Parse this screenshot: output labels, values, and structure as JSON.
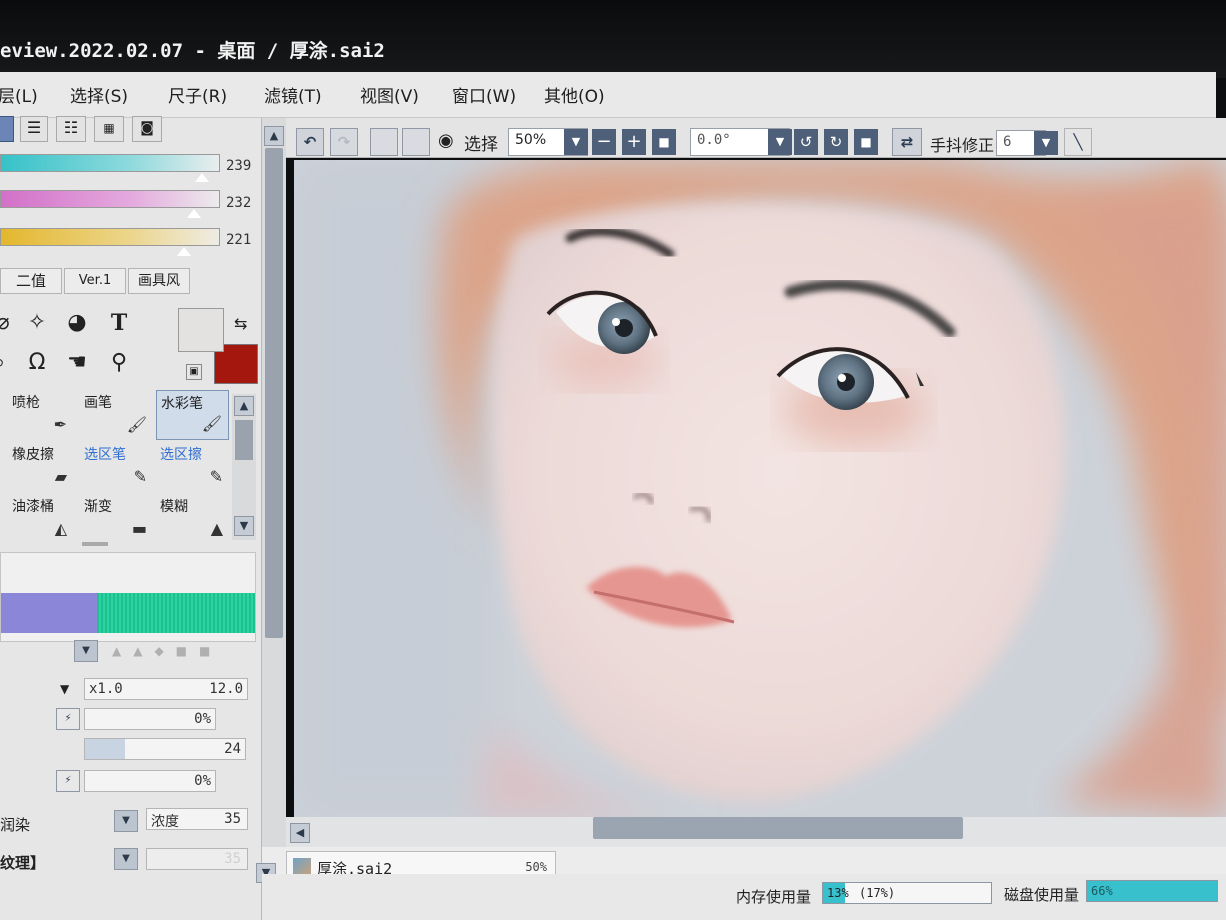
{
  "window": {
    "title": "eview.2022.02.07 - 桌面 / 厚涂.sai2"
  },
  "menu": {
    "items": [
      "层(L)",
      "选择(S)",
      "尺子(R)",
      "滤镜(T)",
      "视图(V)",
      "窗口(W)",
      "其他(O)"
    ]
  },
  "color_sliders": [
    {
      "value": "239",
      "color": "#35c2c8",
      "fill": 0.93
    },
    {
      "value": "232",
      "color": "#d270c8",
      "fill": 0.89
    },
    {
      "value": "221",
      "color": "#e3b72d",
      "fill": 0.84
    }
  ],
  "color_tabs": [
    "二值",
    "Ver.1",
    "画具风"
  ],
  "colors": {
    "foreground": "#e4e2e0",
    "background": "#a4170f",
    "accent": "#4d5f79"
  },
  "tools": {
    "text_tool": "T"
  },
  "brushes": [
    {
      "label": "喷枪",
      "icon": "airbrush-icon",
      "glyph": "✒",
      "link": false
    },
    {
      "label": "画笔",
      "icon": "brush-icon",
      "glyph": "🖌",
      "link": false
    },
    {
      "label": "水彩笔",
      "icon": "watercolor-icon",
      "glyph": "🖌",
      "link": false
    },
    {
      "label": "橡皮擦",
      "icon": "eraser-icon",
      "glyph": "▰",
      "link": false
    },
    {
      "label": "选区笔",
      "icon": "select-pen-icon",
      "glyph": "✎",
      "link": true
    },
    {
      "label": "选区擦",
      "icon": "select-eraser-icon",
      "glyph": "✎",
      "link": true
    },
    {
      "label": "油漆桶",
      "icon": "bucket-icon",
      "glyph": "◭",
      "link": false
    },
    {
      "label": "渐变",
      "icon": "gradient-icon",
      "glyph": "▬",
      "link": false
    },
    {
      "label": "模糊",
      "icon": "blur-icon",
      "glyph": "▲",
      "link": false
    }
  ],
  "brush_selected_index": 2,
  "brush_props": {
    "size_multiplier": "x1.0",
    "size_value": "12.0",
    "min_size": "0%",
    "density": "24",
    "min_density": "0%",
    "blend_label": "润染",
    "concentration_label": "浓度",
    "concentration_value": "35",
    "texture_label": "纹理】",
    "texture_value": "35"
  },
  "toolbar": {
    "select_label": "选择",
    "zoom": "50%",
    "rotation": "0.0°",
    "stabilizer_label": "手抖修正",
    "stabilizer_value": "6"
  },
  "file_tab": {
    "name": "厚涂.sai2",
    "zoom": "50%"
  },
  "status": {
    "memory_label": "内存使用量",
    "memory_value": "13%",
    "memory_extra": "(17%)",
    "memory_fraction": 0.13,
    "disk_label": "磁盘使用量",
    "disk_value": "66%",
    "disk_fraction": 0.66
  }
}
